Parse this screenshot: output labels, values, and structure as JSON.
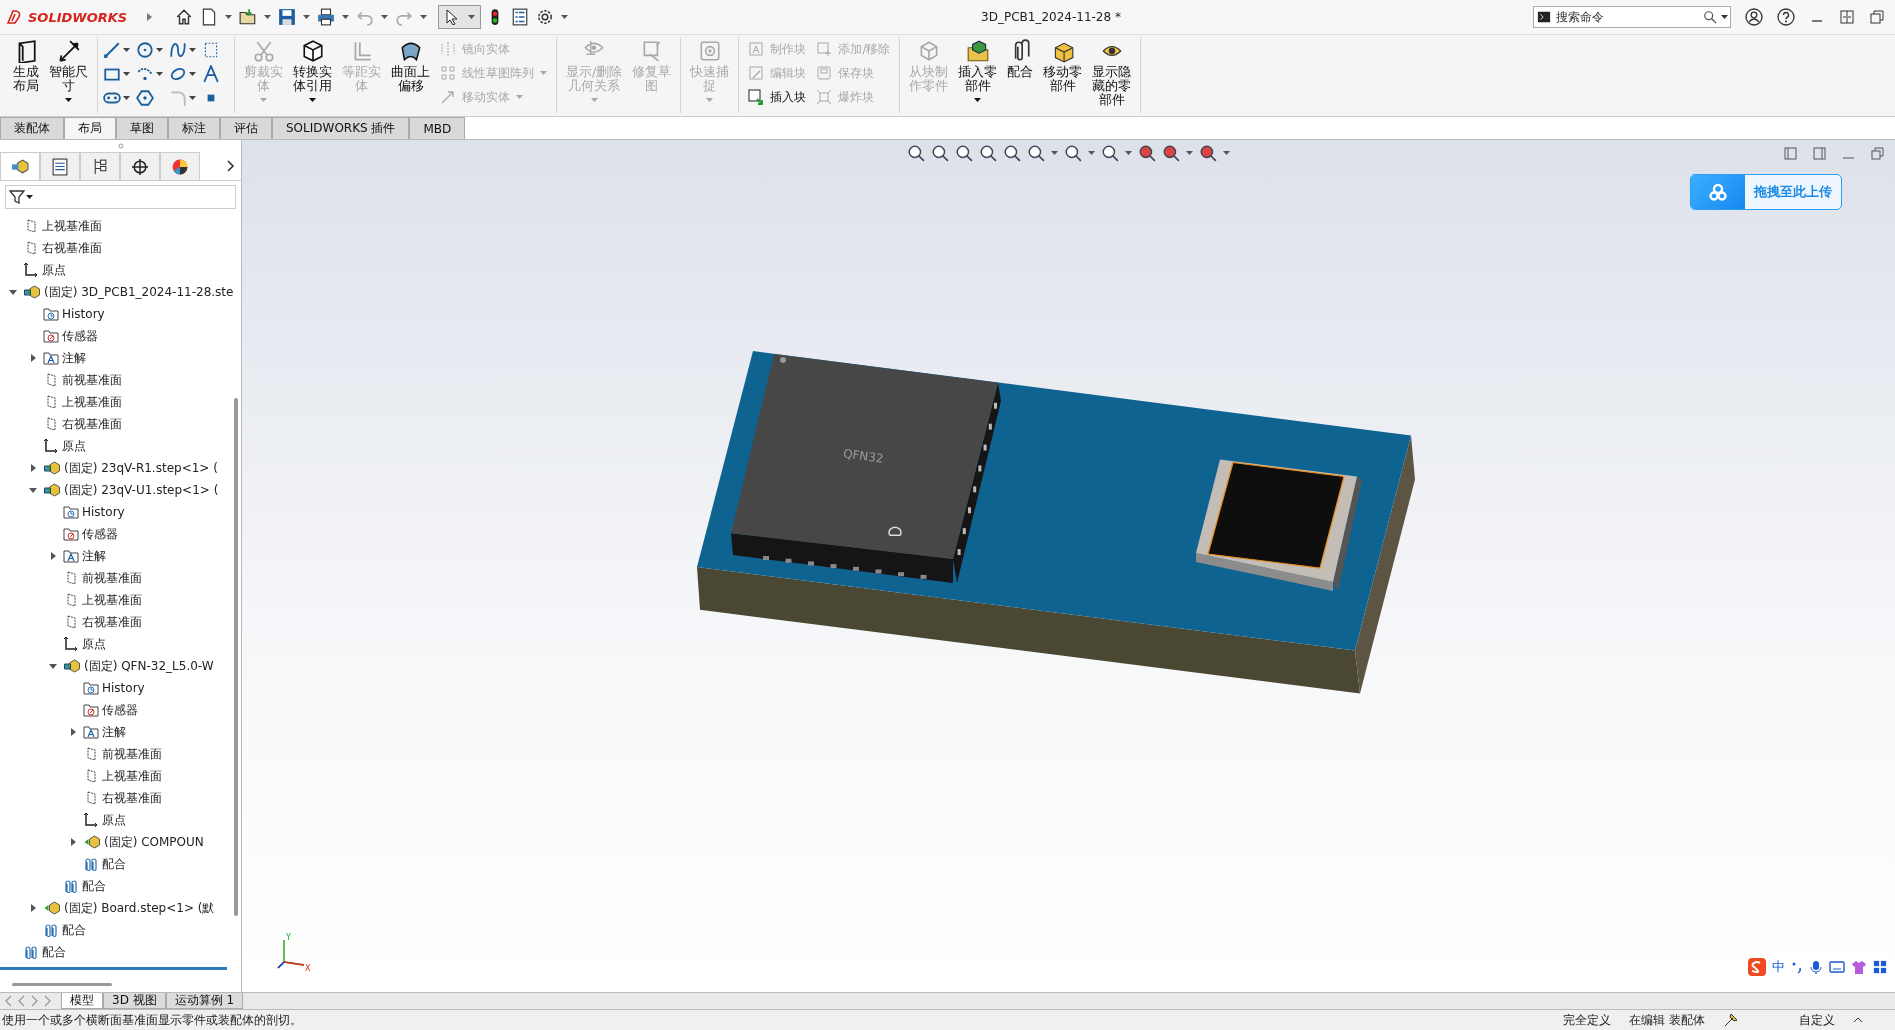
{
  "app": {
    "logo": "SOLIDWORKS",
    "title": "3D_PCB1_2024-11-28 *",
    "search": {
      "placeholder": "搜索命令"
    }
  },
  "ribbon": {
    "groups": [
      [
        {
          "kind": "large",
          "lines": [
            "生成",
            "布局"
          ],
          "disabled": false,
          "dropdown": false
        },
        {
          "kind": "large",
          "lines": [
            "智能尺",
            "寸"
          ],
          "disabled": false,
          "dropdown": true
        }
      ],
      [
        {
          "kind": "sketch-tools"
        }
      ],
      [
        {
          "kind": "large",
          "lines": [
            "剪裁实",
            "体"
          ],
          "disabled": true,
          "dropdown": true
        },
        {
          "kind": "large",
          "lines": [
            "转换实",
            "体引用"
          ],
          "disabled": false,
          "dropdown": true
        },
        {
          "kind": "large",
          "lines": [
            "等距实",
            "体"
          ],
          "disabled": true,
          "dropdown": false
        },
        {
          "kind": "large",
          "lines": [
            "曲面上",
            "偏移"
          ],
          "disabled": false,
          "dropdown": false
        },
        {
          "kind": "small-column",
          "items": [
            {
              "label": "镜向实体",
              "disabled": true,
              "dropdown": false
            },
            {
              "label": "线性草图阵列",
              "disabled": true,
              "dropdown": true
            },
            {
              "label": "移动实体",
              "disabled": true,
              "dropdown": true
            }
          ]
        }
      ],
      [
        {
          "kind": "large",
          "lines": [
            "显示/删除",
            "几何关系"
          ],
          "disabled": true,
          "dropdown": true
        },
        {
          "kind": "large",
          "lines": [
            "修复草",
            "图"
          ],
          "disabled": true,
          "dropdown": false
        }
      ],
      [
        {
          "kind": "large",
          "lines": [
            "快速捕",
            "捉"
          ],
          "disabled": true,
          "dropdown": true
        }
      ],
      [
        {
          "kind": "small-column",
          "items": [
            {
              "label": "制作块",
              "disabled": true,
              "dropdown": false
            },
            {
              "label": "编辑块",
              "disabled": true,
              "dropdown": false
            },
            {
              "label": "插入块",
              "disabled": false,
              "dropdown": false
            }
          ]
        },
        {
          "kind": "small-column",
          "items": [
            {
              "label": "添加/移除",
              "disabled": true,
              "dropdown": false
            },
            {
              "label": "保存块",
              "disabled": true,
              "dropdown": false
            },
            {
              "label": "爆炸块",
              "disabled": true,
              "dropdown": false
            }
          ]
        }
      ],
      [
        {
          "kind": "large",
          "lines": [
            "从块制",
            "作零件"
          ],
          "disabled": true,
          "dropdown": false
        },
        {
          "kind": "large",
          "lines": [
            "插入零",
            "部件"
          ],
          "disabled": false,
          "dropdown": true
        },
        {
          "kind": "large",
          "lines": [
            "配合"
          ],
          "disabled": false,
          "dropdown": false
        },
        {
          "kind": "large",
          "lines": [
            "移动零",
            "部件"
          ],
          "disabled": false,
          "dropdown": false
        },
        {
          "kind": "large",
          "lines": [
            "显示隐",
            "藏的零",
            "部件"
          ],
          "disabled": false,
          "dropdown": false
        }
      ]
    ]
  },
  "tabs": [
    {
      "label": "装配体",
      "selected": false
    },
    {
      "label": "布局",
      "selected": true
    },
    {
      "label": "草图",
      "selected": false
    },
    {
      "label": "标注",
      "selected": false
    },
    {
      "label": "评估",
      "selected": false
    },
    {
      "label": "SOLIDWORKS 插件",
      "selected": false
    },
    {
      "label": "MBD",
      "selected": false
    }
  ],
  "panel_tabs": [
    {
      "selected": true
    },
    {
      "selected": false
    },
    {
      "selected": false
    },
    {
      "selected": false
    },
    {
      "selected": false
    }
  ],
  "tree": {
    "items": [
      {
        "kind": "plane",
        "label": "上视基准面"
      },
      {
        "kind": "plane",
        "label": "右视基准面"
      },
      {
        "kind": "origin",
        "label": "原点"
      },
      {
        "kind": "assembly",
        "label": "(固定) 3D_PCB1_2024-11-28.ste",
        "expanded": true,
        "children": [
          {
            "kind": "history",
            "label": "History"
          },
          {
            "kind": "sensor",
            "label": "传感器"
          },
          {
            "kind": "annotation",
            "label": "注解",
            "expanded": false
          },
          {
            "kind": "plane",
            "label": "前视基准面"
          },
          {
            "kind": "plane",
            "label": "上视基准面"
          },
          {
            "kind": "plane",
            "label": "右视基准面"
          },
          {
            "kind": "origin",
            "label": "原点"
          },
          {
            "kind": "assembly",
            "label": "(固定) 23qV-R1.step<1> (",
            "expanded": false
          },
          {
            "kind": "assembly",
            "label": "(固定) 23qV-U1.step<1> (",
            "expanded": true,
            "children": [
              {
                "kind": "history",
                "label": "History"
              },
              {
                "kind": "sensor",
                "label": "传感器"
              },
              {
                "kind": "annotation",
                "label": "注解",
                "expanded": false
              },
              {
                "kind": "plane",
                "label": "前视基准面"
              },
              {
                "kind": "plane",
                "label": "上视基准面"
              },
              {
                "kind": "plane",
                "label": "右视基准面"
              },
              {
                "kind": "origin",
                "label": "原点"
              },
              {
                "kind": "assembly",
                "label": "(固定) QFN-32_L5.0-W",
                "expanded": true,
                "children": [
                  {
                    "kind": "history",
                    "label": "History"
                  },
                  {
                    "kind": "sensor",
                    "label": "传感器"
                  },
                  {
                    "kind": "annotation",
                    "label": "注解",
                    "expanded": false
                  },
                  {
                    "kind": "plane",
                    "label": "前视基准面"
                  },
                  {
                    "kind": "plane",
                    "label": "上视基准面"
                  },
                  {
                    "kind": "plane",
                    "label": "右视基准面"
                  },
                  {
                    "kind": "origin",
                    "label": "原点"
                  },
                  {
                    "kind": "part",
                    "label": "(固定) COMPOUN",
                    "expanded": false
                  },
                  {
                    "kind": "mate",
                    "label": "配合"
                  }
                ]
              },
              {
                "kind": "mate",
                "label": "配合"
              }
            ]
          },
          {
            "kind": "part",
            "label": "(固定) Board.step<1> (默",
            "expanded": false
          },
          {
            "kind": "mate",
            "label": "配合"
          }
        ]
      },
      {
        "kind": "mate",
        "label": "配合"
      }
    ]
  },
  "viewport": {
    "upload_button": "拖拽至此上传",
    "chip_label": "QFN32",
    "triad": {
      "x": "X",
      "y": "Y"
    },
    "ime": {
      "mode": "中"
    }
  },
  "bottom_tabs": [
    {
      "label": "模型",
      "selected": true
    },
    {
      "label": "3D 视图",
      "selected": false
    },
    {
      "label": "运动算例 1",
      "selected": false
    }
  ],
  "status_bar": {
    "message": "使用一个或多个横断面基准面显示零件或装配体的剖切。",
    "definition": "完全定义",
    "editing": "在编辑 装配体",
    "units": "自定义"
  }
}
